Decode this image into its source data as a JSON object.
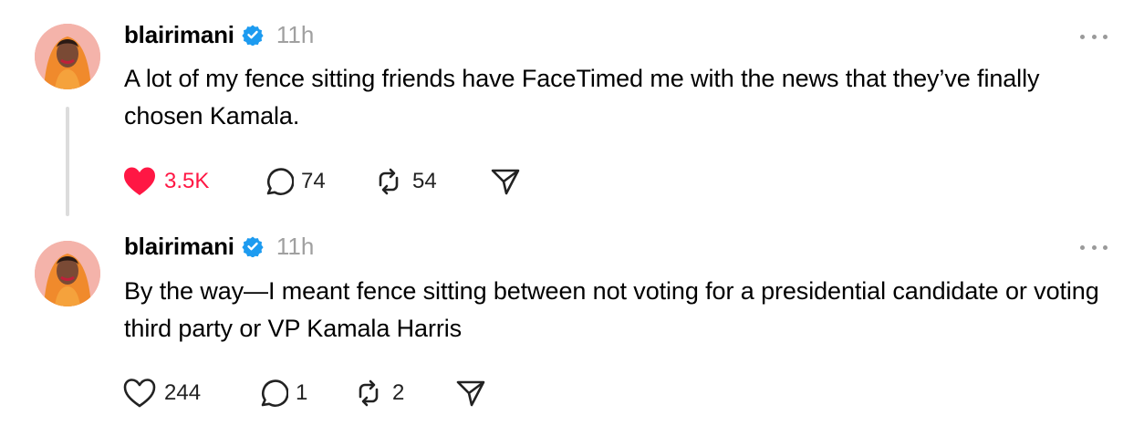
{
  "posts": [
    {
      "username": "blairimani",
      "verified": true,
      "timestamp": "11h",
      "text": "A lot of my fence sitting friends have FaceTimed me with the news that they’ve finally chosen Kamala.",
      "likes": "3.5K",
      "liked": true,
      "replies": "74",
      "reposts": "54"
    },
    {
      "username": "blairimani",
      "verified": true,
      "timestamp": "11h",
      "text": "By the way—I meant fence sitting between not voting for a presidential candidate or voting third party or VP Kamala Harris",
      "likes": "244",
      "liked": false,
      "replies": "1",
      "reposts": "2"
    }
  ],
  "icons": {
    "verified": "verified-badge-icon",
    "more": "more-options-icon",
    "like": "heart-icon",
    "reply": "reply-bubble-icon",
    "repost": "repost-icon",
    "share": "share-icon"
  },
  "colors": {
    "verified_blue": "#1d9bf0",
    "liked_red": "#ff1744",
    "muted_gray": "#a0a0a0",
    "thread_line": "#dcdcdc"
  }
}
